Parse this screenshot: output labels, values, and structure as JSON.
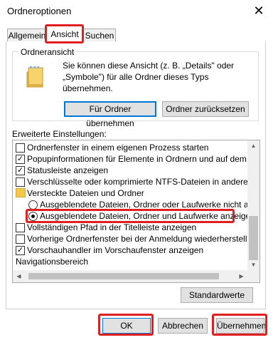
{
  "window": {
    "title": "Ordneroptionen",
    "close": "✕"
  },
  "tabs": [
    {
      "label": "Allgemein"
    },
    {
      "label": "Ansicht"
    },
    {
      "label": "Suchen"
    }
  ],
  "folder_view": {
    "group_label": "Ordneransicht",
    "description": "Sie können diese Ansicht (z. B. „Details\" oder „Symbole\") für alle Ordner dieses Typs übernehmen.",
    "apply_button": "Für Ordner übernehmen",
    "reset_button": "Ordner zurücksetzen"
  },
  "advanced": {
    "label": "Erweiterte Einstellungen:",
    "items": [
      {
        "type": "checkbox",
        "checked": false,
        "label": "Ordnerfenster in einem eigenen Prozess starten"
      },
      {
        "type": "checkbox",
        "checked": true,
        "label": "Popupinformationen für Elemente in Ordnern und auf dem Desktop"
      },
      {
        "type": "checkbox",
        "checked": true,
        "label": "Statusleiste anzeigen"
      },
      {
        "type": "checkbox",
        "checked": false,
        "label": "Verschlüsselte oder komprimierte NTFS-Dateien in anderer Farbe"
      },
      {
        "type": "folder",
        "label": "Versteckte Dateien und Ordner"
      },
      {
        "type": "radio",
        "checked": false,
        "label": "Ausgeblendete Dateien, Ordner oder Laufwerke nicht anzeigen"
      },
      {
        "type": "radio",
        "checked": true,
        "label": "Ausgeblendete Dateien, Ordner und Laufwerke anzeigen"
      },
      {
        "type": "checkbox",
        "checked": false,
        "label": "Vollständigen Pfad in der Titelleiste anzeigen"
      },
      {
        "type": "checkbox",
        "checked": false,
        "label": "Vorherige Ordnerfenster bei der Anmeldung wiederherstellen"
      },
      {
        "type": "checkbox",
        "checked": true,
        "label": "Vorschauhandler im Vorschaufenster anzeigen"
      },
      {
        "type": "plain",
        "label": "Navigationsbereich"
      }
    ]
  },
  "defaults_button": "Standardwerte",
  "footer": {
    "ok": "OK",
    "cancel": "Abbrechen",
    "apply": "Übernehmen"
  },
  "colors": {
    "highlight": "#e02020",
    "focus": "#0078d7",
    "folder": "#f2c94c"
  }
}
